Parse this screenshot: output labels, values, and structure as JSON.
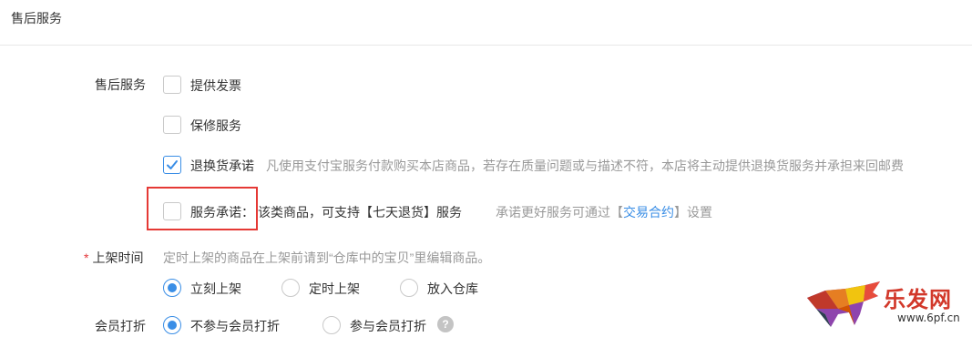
{
  "header": {
    "title": "售后服务"
  },
  "after_sales": {
    "label": "售后服务",
    "options": [
      {
        "label": "提供发票",
        "checked": false
      },
      {
        "label": "保修服务",
        "checked": false
      },
      {
        "label": "退换货承诺",
        "checked": true,
        "hint": "凡使用支付宝服务付款购买本店商品，若存在质量问题或与描述不符，本店将主动提供退换货服务并承担来回邮费"
      },
      {
        "label": "服务承诺：",
        "checked": false,
        "desc": "该类商品，可支持【七天退货】服务",
        "hint_prefix": "承诺更好服务可通过【",
        "hint_link": "交易合约",
        "hint_suffix": "】设置"
      }
    ]
  },
  "listing_time": {
    "required_mark": "*",
    "label": "上架时间",
    "hint": "定时上架的商品在上架前请到“仓库中的宝贝”里编辑商品。",
    "options": [
      {
        "label": "立刻上架",
        "selected": true
      },
      {
        "label": "定时上架",
        "selected": false
      },
      {
        "label": "放入仓库",
        "selected": false
      }
    ]
  },
  "member_discount": {
    "label": "会员打折",
    "options": [
      {
        "label": "不参与会员打折",
        "selected": true
      },
      {
        "label": "参与会员打折",
        "selected": false
      }
    ],
    "help_icon": "?"
  },
  "watermark": {
    "text": "乐发网",
    "url": "www.6pf.cn",
    "icon": "bull-logo"
  },
  "colors": {
    "accent": "#3a8ee6",
    "highlight": "#e53935",
    "required": "#e4393c"
  }
}
